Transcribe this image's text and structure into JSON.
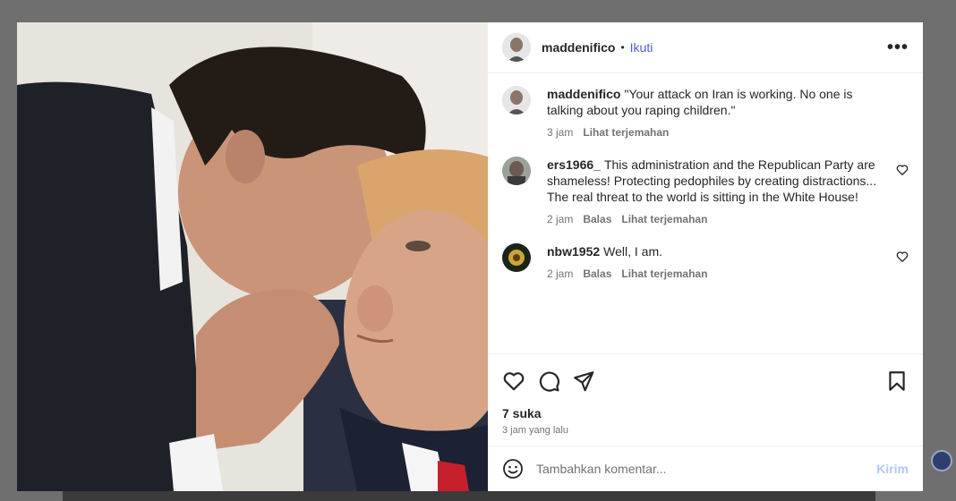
{
  "post": {
    "username": "maddenifico",
    "separator": "•",
    "follow_label": "Ikuti",
    "more_label": "•••"
  },
  "caption": {
    "username": "maddenifico",
    "text": "\"Your attack on Iran is working. No one is talking about you raping children.\"",
    "time": "3 jam",
    "translate_label": "Lihat terjemahan"
  },
  "comments": [
    {
      "username": "ers1966_",
      "text": "This administration and the Republican Party are shameless! Protecting pedophiles by creating distractions... The real threat to the world is sitting in the White House!",
      "time": "2 jam",
      "reply_label": "Balas",
      "translate_label": "Lihat terjemahan"
    },
    {
      "username": "nbw1952",
      "text": "Well, I am.",
      "time": "2 jam",
      "reply_label": "Balas",
      "translate_label": "Lihat terjemahan"
    }
  ],
  "actions": {
    "likes": "7 suka",
    "posted_time": "3 jam yang lalu"
  },
  "composer": {
    "placeholder": "Tambahkan komentar...",
    "post_label": "Kirim"
  },
  "icons": {
    "like": "heart-icon",
    "comment": "comment-bubble-icon",
    "share": "paper-plane-icon",
    "save": "bookmark-icon",
    "emoji": "smiley-icon",
    "more": "more-dots-icon"
  },
  "colors": {
    "follow": "#4f5bd5",
    "post_button_disabled": "#b2c7f5",
    "meta_text": "#737373"
  }
}
